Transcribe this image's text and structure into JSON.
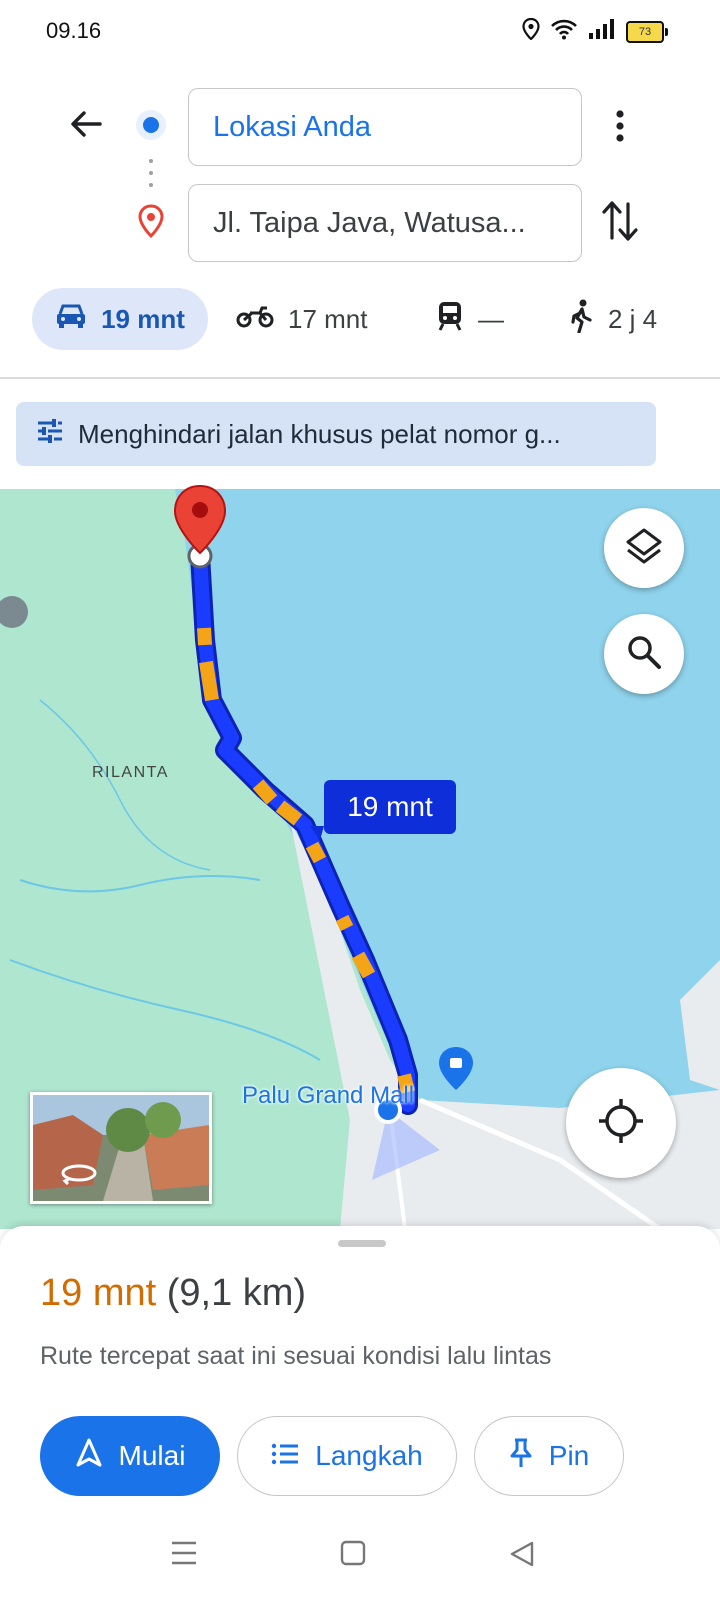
{
  "status_bar": {
    "time": "09.16",
    "battery": "73",
    "icons": [
      "location-icon",
      "wifi-icon",
      "signal-icon",
      "battery-icon"
    ]
  },
  "header": {
    "origin": "Lokasi Anda",
    "destination": "Jl. Taipa Java, Watusa...",
    "icons": [
      "back-arrow-icon",
      "more-vert-icon",
      "swap-icon"
    ]
  },
  "modes": [
    {
      "name": "car",
      "label": "19 mnt",
      "icon": "car-icon",
      "selected": true
    },
    {
      "name": "motorcycle",
      "label": "17 mnt",
      "icon": "motorcycle-icon"
    },
    {
      "name": "transit",
      "label": "—",
      "icon": "train-icon"
    },
    {
      "name": "walk",
      "label": "2 j 4",
      "icon": "walk-icon"
    }
  ],
  "option_chip": {
    "label": "Menghindari jalan khusus pelat nomor g...",
    "icon": "tune-icon"
  },
  "map": {
    "route_label": "19 mnt",
    "place_label": "Palu Grand Mall",
    "area_label": "RILANTA",
    "colors": {
      "water": "#8fd3ec",
      "land": "#aee6cf",
      "route": "#1a3cff",
      "traffic": "#f4a417",
      "pin": "#ea4335"
    }
  },
  "sheet": {
    "duration": "19 mnt",
    "distance": "(9,1 km)",
    "description": "Rute tercepat saat ini sesuai kondisi lalu lintas",
    "buttons": {
      "start": "Mulai",
      "steps": "Langkah",
      "pin": "Pin"
    }
  },
  "nav_bar": [
    "menu-icon",
    "home-icon",
    "back-icon"
  ]
}
